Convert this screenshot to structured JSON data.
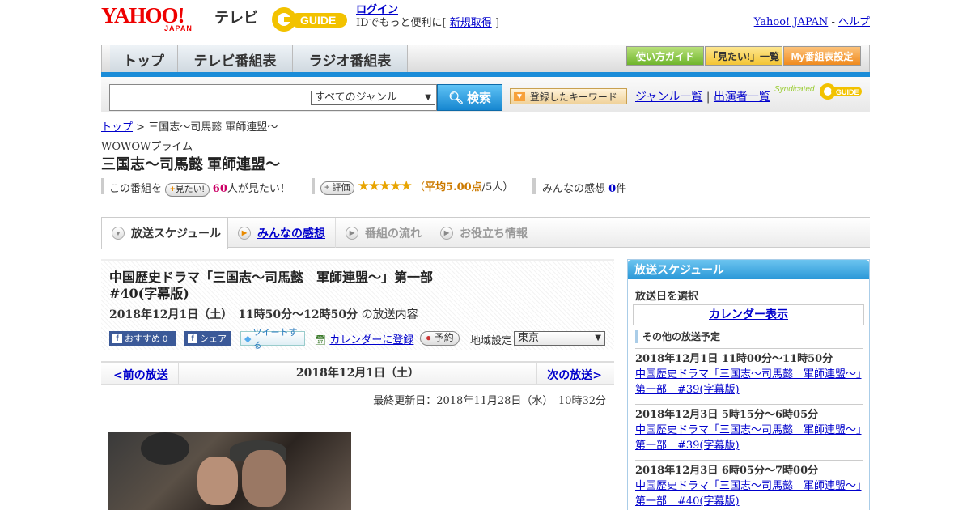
{
  "header": {
    "logo_yahoo": "YAHOO!",
    "logo_japan": "JAPAN",
    "logo_tv": "テレビ",
    "login_link": "ログイン",
    "id_text": "IDでもっと便利に[",
    "signup_link": "新規取得",
    "id_close": "]",
    "yahoo_japan_link": "Yahoo! JAPAN",
    "separator": "-",
    "help_link": "ヘルプ"
  },
  "nav": {
    "tabs": [
      "トップ",
      "テレビ番組表",
      "ラジオ番組表"
    ],
    "buttons": [
      "使い方ガイド",
      "「見たい!」一覧",
      "My番組表設定"
    ]
  },
  "search": {
    "genre_selected": "すべてのジャンル",
    "search_label": "検索",
    "keyword_label": "登録したキーワード",
    "genre_list_link": "ジャンル一覧",
    "divider": "|",
    "performers_link": "出演者一覧",
    "syndicated": "Syndicated"
  },
  "breadcrumb": {
    "top": "トップ",
    "sep": ">",
    "current": "三国志～司馬懿 軍師連盟～"
  },
  "program": {
    "station": "WOWOWプライム",
    "title": "三国志～司馬懿 軍師連盟～",
    "watch_prefix": "この番組を",
    "watch_pill": "見たい!",
    "watch_count": "60",
    "watch_suffix": "人が見たい！",
    "rate_pill": "評価",
    "stars": "★★★★★",
    "avg_open": "（",
    "avg_label": "平均5.00点",
    "avg_count": "/5人）",
    "impressions_prefix": "みんなの感想",
    "impressions_count": "0",
    "impressions_suffix": "件"
  },
  "tabs": [
    "放送スケジュール",
    "みんなの感想",
    "番組の流れ",
    "お役立ち情報"
  ],
  "episode": {
    "title_line1": "中国歴史ドラマ「三国志～司馬懿　軍師連盟～」第一部",
    "title_line2": "#40(字幕版)",
    "date": "2018年12月1日（土）　11時50分～12時50分",
    "date_suffix": "の放送内容",
    "fb_recommend": "おすすめ 0",
    "fb_share": "シェア",
    "tweet": "ツイートする",
    "calendar_register": "カレンダーに登録",
    "reserve": "予約",
    "region_label": "地域設定",
    "region_value": "東京"
  },
  "day_nav": {
    "prev": "<前の放送",
    "current": "2018年12月1日（土）",
    "next": "次の放送>"
  },
  "updated": "最終更新日：2018年11月28日（水）　10時32分",
  "sidebar": {
    "heading": "放送スケジュール",
    "select_date": "放送日を選択",
    "calendar_link": "カレンダー表示",
    "other_heading": "その他の放送予定",
    "items": [
      {
        "time": "2018年12月1日  11時00分～11時50分",
        "link": "中国歴史ドラマ「三国志～司馬懿　軍師連盟～」第一部　#39(字幕版)"
      },
      {
        "time": "2018年12月3日  5時15分～6時05分",
        "link": "中国歴史ドラマ「三国志～司馬懿　軍師連盟～」第一部　#39(字幕版)"
      },
      {
        "time": "2018年12月3日  6時05分～7時00分",
        "link": "中国歴史ドラマ「三国志～司馬懿　軍師連盟～」第一部　#40(字幕版)"
      }
    ]
  }
}
